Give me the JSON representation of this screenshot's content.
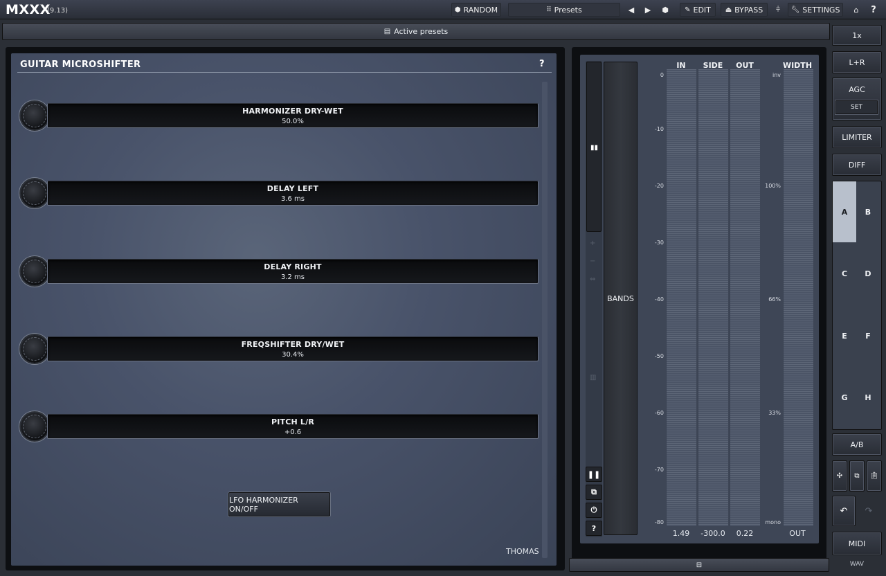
{
  "header": {
    "app_title": "MXXX",
    "version": "(9.13)",
    "random_label": "RANDOM",
    "presets_label": "Presets",
    "edit_label": "EDIT",
    "bypass_label": "BYPASS",
    "settings_label": "SETTINGS",
    "help_label": "?"
  },
  "active_presets_label": "Active presets",
  "panel": {
    "title": "GUITAR MICROSHIFTER",
    "help": "?",
    "author": "THOMAS",
    "sliders": [
      {
        "label": "HARMONIZER DRY-WET",
        "value": "50.0%"
      },
      {
        "label": "DELAY LEFT",
        "value": "3.6 ms"
      },
      {
        "label": "DELAY RIGHT",
        "value": "3.2 ms"
      },
      {
        "label": "FREQSHIFTER DRY/WET",
        "value": "30.4%"
      },
      {
        "label": "PITCH L/R",
        "value": "+0.6"
      }
    ],
    "lfo_button": "LFO HARMONIZER ON/OFF"
  },
  "meters": {
    "bands_label": "BANDS",
    "heads": {
      "in": "IN",
      "side": "SIDE",
      "out": "OUT",
      "width": "WIDTH"
    },
    "db_ticks": [
      "0",
      "-10",
      "-20",
      "-30",
      "-40",
      "-50",
      "-60",
      "-70",
      "-80"
    ],
    "width_ticks": [
      "inv",
      "100%",
      "66%",
      "33%",
      "mono"
    ],
    "footer": {
      "in": "1.49",
      "side": "-300.0",
      "out": "0.22",
      "width": "OUT"
    },
    "help": "?"
  },
  "sidebar": {
    "zoom": "1x",
    "channel": "L+R",
    "agc": "AGC",
    "agc_set": "SET",
    "limiter": "LIMITER",
    "diff": "DIFF",
    "slots": [
      "A",
      "B",
      "C",
      "D",
      "E",
      "F",
      "G",
      "H"
    ],
    "active_slot": "A",
    "ab": "A/B",
    "midi": "MIDI",
    "wav": "WAV"
  }
}
